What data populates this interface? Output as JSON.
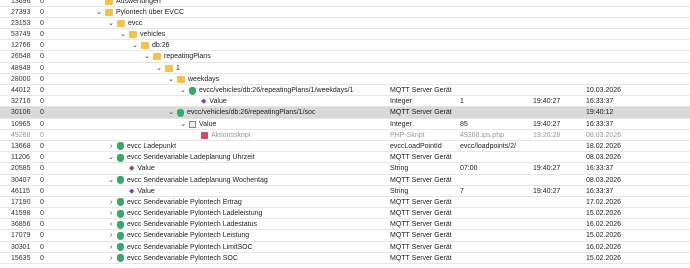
{
  "rows": [
    {
      "id": "13696",
      "parent": "0",
      "label": "Auswertungen",
      "chev": "",
      "icon": "folder",
      "level": 5,
      "type": "",
      "value": "",
      "time1": "",
      "time2": "",
      "muted": false,
      "selected": false
    },
    {
      "id": "27393",
      "parent": "0",
      "label": "Pylontech über EVCC",
      "chev": "⌄",
      "icon": "folder",
      "level": 5,
      "type": "",
      "value": "",
      "time1": "",
      "time2": "",
      "muted": false,
      "selected": false
    },
    {
      "id": "23153",
      "parent": "0",
      "label": "evcc",
      "chev": "⌄",
      "icon": "folder",
      "level": 6,
      "type": "",
      "value": "",
      "time1": "",
      "time2": "",
      "muted": false,
      "selected": false
    },
    {
      "id": "53749",
      "parent": "0",
      "label": "vehicles",
      "chev": "⌄",
      "icon": "folder",
      "level": 7,
      "type": "",
      "value": "",
      "time1": "",
      "time2": "",
      "muted": false,
      "selected": false
    },
    {
      "id": "12766",
      "parent": "0",
      "label": "db:26",
      "chev": "⌄",
      "icon": "folder",
      "level": 8,
      "type": "",
      "value": "",
      "time1": "",
      "time2": "",
      "muted": false,
      "selected": false
    },
    {
      "id": "26548",
      "parent": "0",
      "label": "repeatingPlans",
      "chev": "⌄",
      "icon": "folder",
      "level": 9,
      "type": "",
      "value": "",
      "time1": "",
      "time2": "",
      "muted": false,
      "selected": false
    },
    {
      "id": "48948",
      "parent": "0",
      "label": "1",
      "chev": "⌄",
      "icon": "folder",
      "level": 10,
      "type": "",
      "value": "",
      "time1": "",
      "time2": "",
      "muted": false,
      "selected": false
    },
    {
      "id": "28000",
      "parent": "0",
      "label": "weekdays",
      "chev": "⌄",
      "icon": "folder",
      "level": 11,
      "type": "",
      "value": "",
      "time1": "",
      "time2": "",
      "muted": false,
      "selected": false
    },
    {
      "id": "44012",
      "parent": "0",
      "label": "evcc/vehicles/db:26/repeatingPlans/1/weekdays/1",
      "chev": "⌄",
      "icon": "instance",
      "level": 12,
      "type": "MQTT Server Gerät",
      "value": "",
      "time1": "",
      "time2": "10.03.2026",
      "muted": false,
      "selected": false
    },
    {
      "id": "32716",
      "parent": "0",
      "label": "Value",
      "chev": "",
      "icon": "variable",
      "level": 13,
      "type": "Integer",
      "value": "1",
      "time1": "19:40:27",
      "time2": "16:33:37",
      "muted": false,
      "selected": false
    },
    {
      "id": "30106",
      "parent": "0",
      "label": "evcc/vehicles/db:26/repeatingPlans/1/soc",
      "chev": "⌄",
      "icon": "instance",
      "level": 11,
      "type": "MQTT Server Gerät",
      "value": "",
      "time1": "",
      "time2": "19:40:12",
      "muted": false,
      "selected": true
    },
    {
      "id": "10965",
      "parent": "0",
      "label": "Value",
      "chev": "⌄",
      "icon": "event",
      "level": 12,
      "type": "Integer",
      "value": "85",
      "time1": "19:40:27",
      "time2": "16:33:37",
      "muted": false,
      "selected": false
    },
    {
      "id": "49268",
      "parent": "0",
      "label": "Aktionsskript",
      "chev": "",
      "icon": "script",
      "level": 13,
      "type": "PHP-Skript",
      "value": "49268.ips.php",
      "time1": "19:26:28",
      "time2": "08.03.2026",
      "muted": true,
      "selected": false
    },
    {
      "id": "13668",
      "parent": "0",
      "label": "evcc Ladepunkt",
      "chev": "›",
      "icon": "instance",
      "level": 6,
      "type": "evccLoadPointId",
      "value": "evcc/loadpoints/2/",
      "time1": "",
      "time2": "18.02.2026",
      "muted": false,
      "selected": false
    },
    {
      "id": "11206",
      "parent": "0",
      "label": "evcc Sendevariable Ladeplanung Uhrzeit",
      "chev": "⌄",
      "icon": "instance",
      "level": 6,
      "type": "MQTT Server Gerät",
      "value": "",
      "time1": "",
      "time2": "08.03.2026",
      "muted": false,
      "selected": false
    },
    {
      "id": "20585",
      "parent": "0",
      "label": "Value",
      "chev": "",
      "icon": "variable",
      "level": 7,
      "type": "String",
      "value": "07:00",
      "time1": "19:40:27",
      "time2": "16:33:37",
      "muted": false,
      "selected": false
    },
    {
      "id": "30407",
      "parent": "0",
      "label": "evcc Sendevariable Ladeplanung Wochentag",
      "chev": "⌄",
      "icon": "instance",
      "level": 6,
      "type": "MQTT Server Gerät",
      "value": "",
      "time1": "",
      "time2": "08.03.2026",
      "muted": false,
      "selected": false
    },
    {
      "id": "46115",
      "parent": "0",
      "label": "Value",
      "chev": "",
      "icon": "variable",
      "level": 7,
      "type": "String",
      "value": "7",
      "time1": "19:40:27",
      "time2": "16:33:37",
      "muted": false,
      "selected": false
    },
    {
      "id": "17190",
      "parent": "0",
      "label": "evcc Sendevariable Pylontech Ertrag",
      "chev": "›",
      "icon": "instance",
      "level": 6,
      "type": "MQTT Server Gerät",
      "value": "",
      "time1": "",
      "time2": "17.02.2026",
      "muted": false,
      "selected": false
    },
    {
      "id": "41598",
      "parent": "0",
      "label": "evcc Sendevariable Pylontech Ladeleistung",
      "chev": "›",
      "icon": "instance",
      "level": 6,
      "type": "MQTT Server Gerät",
      "value": "",
      "time1": "",
      "time2": "15.02.2026",
      "muted": false,
      "selected": false
    },
    {
      "id": "36856",
      "parent": "0",
      "label": "evcc Sendevariable Pylontech Ladestatus",
      "chev": "›",
      "icon": "instance",
      "level": 6,
      "type": "MQTT Server Gerät",
      "value": "",
      "time1": "",
      "time2": "16.02.2026",
      "muted": false,
      "selected": false
    },
    {
      "id": "17079",
      "parent": "0",
      "label": "evcc Sendevariable Pylontech Leistung",
      "chev": "›",
      "icon": "instance",
      "level": 6,
      "type": "MQTT Server Gerät",
      "value": "",
      "time1": "",
      "time2": "15.02.2026",
      "muted": false,
      "selected": false
    },
    {
      "id": "30301",
      "parent": "0",
      "label": "evcc Sendevariable Pylontech LimitSOC",
      "chev": "›",
      "icon": "instance",
      "level": 6,
      "type": "MQTT Server Gerät",
      "value": "",
      "time1": "",
      "time2": "16.02.2026",
      "muted": false,
      "selected": false
    },
    {
      "id": "15635",
      "parent": "0",
      "label": "evcc Sendevariable Pylontech SOC",
      "chev": "›",
      "icon": "instance",
      "level": 6,
      "type": "MQTT Server Gerät",
      "value": "",
      "time1": "",
      "time2": "15.02.2026",
      "muted": false,
      "selected": false
    }
  ]
}
